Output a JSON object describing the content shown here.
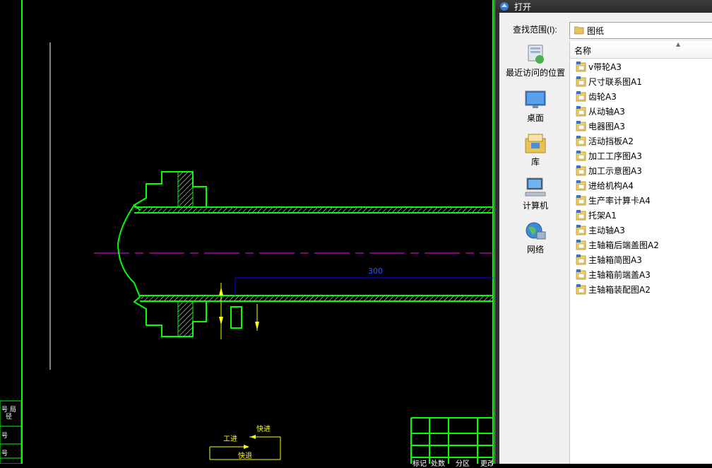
{
  "cad": {
    "dimension_value": "300",
    "labels": {
      "gongjin": "工进",
      "kuaijin": "快进",
      "kuaitui": "快退"
    },
    "title_block_left": [
      "号 局",
      "径",
      "号",
      "号"
    ],
    "title_block_bottom": [
      "标记",
      "处数",
      "分区",
      "更改"
    ],
    "colors": {
      "outline": "#00ff00",
      "centerline": "#ff00ff",
      "dimension": "#0000ff",
      "annotation": "#ffff00"
    }
  },
  "dialog": {
    "title": "打开",
    "look_in_label": "查找范围(I):",
    "look_in_value": "图纸",
    "places": [
      {
        "label": "最近访问的位置",
        "icon": "recent-places-icon"
      },
      {
        "label": "桌面",
        "icon": "desktop-icon"
      },
      {
        "label": "库",
        "icon": "libraries-icon"
      },
      {
        "label": "计算机",
        "icon": "computer-icon"
      },
      {
        "label": "网络",
        "icon": "network-icon"
      }
    ],
    "column_header": "名称",
    "files": [
      "v带轮A3",
      "尺寸联系图A1",
      "齿轮A3",
      "从动轴A3",
      "电器图A3",
      "活动挡板A2",
      "加工工序图A3",
      "加工示意图A3",
      "进给机构A4",
      "生产率计算卡A4",
      "托架A1",
      "主动轴A3",
      "主轴箱后端盖图A2",
      "主轴箱简图A3",
      "主轴箱前端盖A3",
      "主轴箱装配图A2"
    ]
  }
}
